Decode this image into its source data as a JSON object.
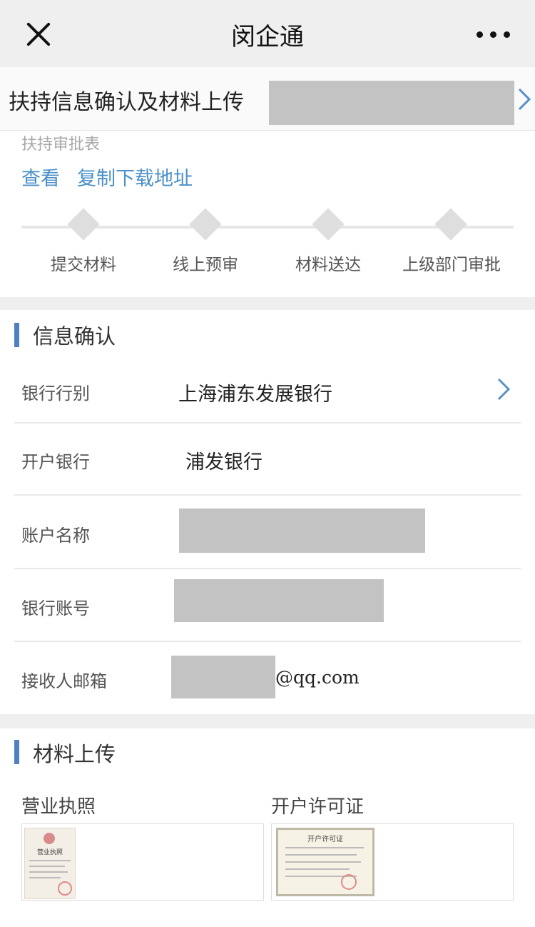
{
  "nav": {
    "title": "闵企通",
    "close_icon": "close-icon",
    "more_icon": "more-icon"
  },
  "subheader": {
    "title": "扶持信息确认及材料上传",
    "chevron_icon": "chevron-right-icon"
  },
  "approval": {
    "label": "扶持审批表",
    "view_link": "查看",
    "copy_link": "复制下载地址"
  },
  "steps": [
    {
      "label": "提交材料"
    },
    {
      "label": "线上预审"
    },
    {
      "label": "材料送达"
    },
    {
      "label": "上级部门审批"
    }
  ],
  "info_section": {
    "title": "信息确认",
    "rows": [
      {
        "label": "银行行别",
        "value": "上海浦东发展银行"
      },
      {
        "label": "开户银行",
        "value": "浦发银行"
      },
      {
        "label": "账户名称",
        "value": ""
      },
      {
        "label": "银行账号",
        "value": ""
      },
      {
        "label": "接收人邮箱",
        "value": "@qq.com"
      }
    ]
  },
  "upload_section": {
    "title": "材料上传",
    "items": [
      {
        "label": "营业执照",
        "thumb_text": "营业执照"
      },
      {
        "label": "开户许可证",
        "thumb_text": "开户许可证"
      }
    ]
  },
  "colors": {
    "accent": "#4f80c1",
    "link": "#4a90c8",
    "redaction": "#c3c3c3"
  }
}
